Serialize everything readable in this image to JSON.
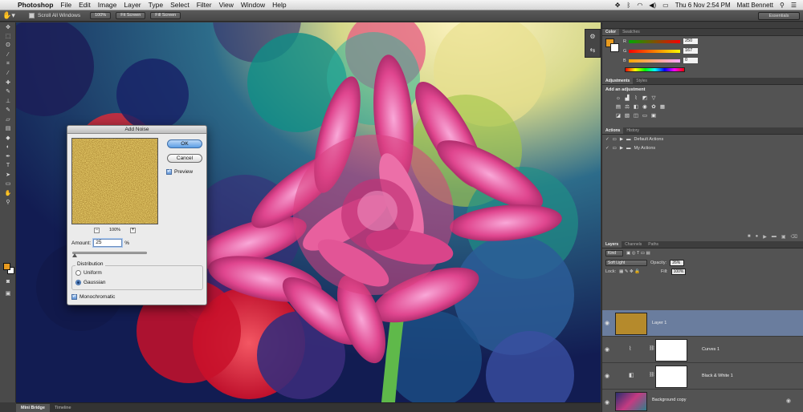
{
  "menubar": {
    "app": "Photoshop",
    "items": [
      "File",
      "Edit",
      "Image",
      "Layer",
      "Type",
      "Select",
      "Filter",
      "View",
      "Window",
      "Help"
    ],
    "clock": "Thu 6 Nov  2:54 PM",
    "user": "Matt Bennett"
  },
  "optionsbar": {
    "scroll_all": "Scroll All Windows",
    "buttons": [
      "100%",
      "Fit Screen",
      "Fill Screen"
    ],
    "workspace": "Essentials"
  },
  "color_panel": {
    "tabs": [
      "Color",
      "Swatches"
    ],
    "r_label": "R",
    "r_value": "250",
    "g_label": "G",
    "g_value": "167",
    "b_label": "B",
    "b_value": "0",
    "foreground": "#e79a1f"
  },
  "adjustments_panel": {
    "tabs": [
      "Adjustments",
      "Styles"
    ],
    "title": "Add an adjustment"
  },
  "actions_panel": {
    "tabs": [
      "Actions",
      "History"
    ],
    "items": [
      "Default Actions",
      "My Actions"
    ]
  },
  "layers_panel": {
    "tabs": [
      "Layers",
      "Channels",
      "Paths"
    ],
    "kind": "Kind",
    "blend_mode": "Soft Light",
    "opacity_label": "Opacity:",
    "opacity": "26%",
    "lock_label": "Lock:",
    "fill_label": "Fill:",
    "fill": "100%",
    "layers": [
      "Layer 1",
      "Curves 1",
      "Black & White 1",
      "Background copy"
    ]
  },
  "bridge": {
    "tabs": [
      "Mini Bridge",
      "Timeline"
    ]
  },
  "dialog": {
    "title": "Add Noise",
    "ok": "OK",
    "cancel": "Cancel",
    "preview_label": "Preview",
    "zoom": "100%",
    "amount_label": "Amount:",
    "amount_value": "25",
    "percent": "%",
    "distribution_label": "Distribution",
    "uniform": "Uniform",
    "gaussian": "Gaussian",
    "monochromatic": "Monochromatic"
  }
}
